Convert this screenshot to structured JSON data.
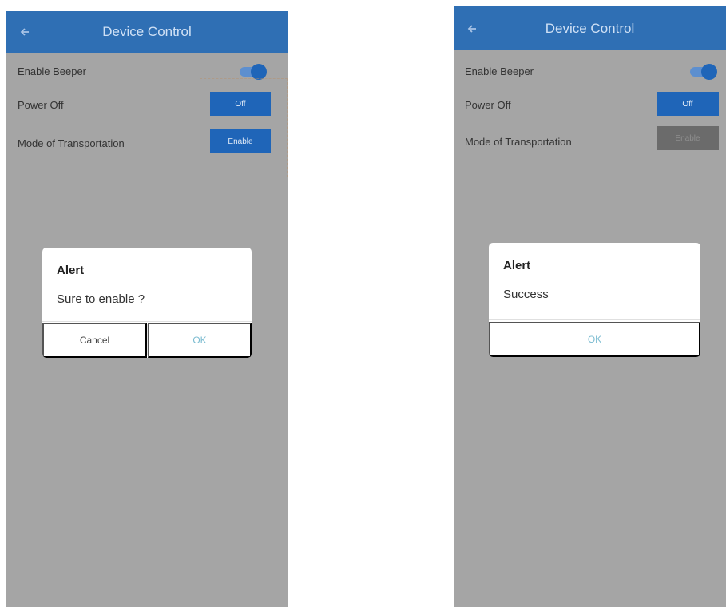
{
  "left_screen": {
    "app_bar": {
      "title": "Device Control",
      "back_icon": "arrow-left-icon"
    },
    "settings": {
      "beeper": {
        "label": "Enable Beeper",
        "enabled": true
      },
      "power_off": {
        "label": "Power Off",
        "button_label": "Off"
      },
      "transport_mode": {
        "label": "Mode of Transportation",
        "button_label": "Enable"
      }
    },
    "dialog": {
      "title": "Alert",
      "message": "Sure to enable ?",
      "cancel_label": "Cancel",
      "ok_label": "OK"
    }
  },
  "right_screen": {
    "app_bar": {
      "title": "Device Control",
      "back_icon": "arrow-left-icon"
    },
    "settings": {
      "beeper": {
        "label": "Enable Beeper",
        "enabled": true
      },
      "power_off": {
        "label": "Power Off",
        "button_label": "Off"
      },
      "transport_mode": {
        "label": "Mode of Transportation",
        "button_label": "Enable",
        "disabled": true
      }
    },
    "dialog": {
      "title": "Alert",
      "message": "Success",
      "ok_label": "OK"
    }
  },
  "colors": {
    "app_bar": "#2f6fb4",
    "primary_button": "#1f65b8",
    "disabled_button": "#6b6b6b",
    "overlay": "#a5a5a5",
    "ok_text": "#7cbcd1"
  }
}
